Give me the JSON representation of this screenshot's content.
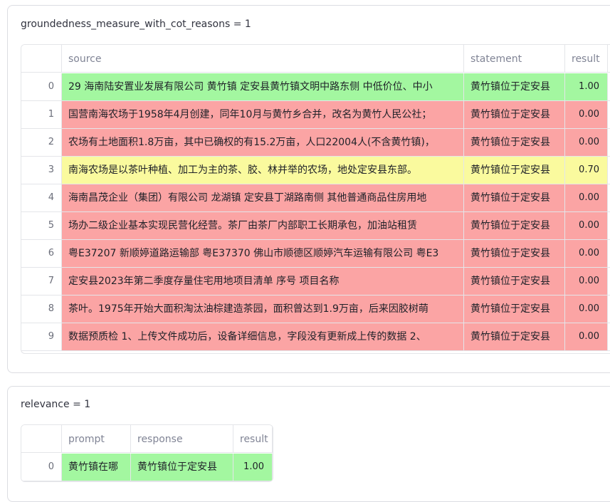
{
  "groundedness": {
    "title": "groundedness_measure_with_cot_reasons = 1",
    "columns": [
      "source",
      "statement",
      "result"
    ],
    "rows": [
      {
        "index": "0",
        "source": "29 海南陆安置业发展有限公司 黄竹镇 定安县黄竹镇文明中路东侧 中低价位、中小",
        "statement": "黄竹镇位于定安县",
        "result": "1.00",
        "color": "green"
      },
      {
        "index": "1",
        "source": "国营南海农场于1958年4月创建，同年10月与黄竹乡合并，改名为黄竹人民公社；",
        "statement": "黄竹镇位于定安县",
        "result": "0.00",
        "color": "red"
      },
      {
        "index": "2",
        "source": "农场有土地面积1.8万亩，其中已确权的有15.2万亩，人口22004人(不含黄竹镇)，",
        "statement": "黄竹镇位于定安县",
        "result": "0.00",
        "color": "red"
      },
      {
        "index": "3",
        "source": "南海农场是以茶叶种植、加工为主的茶、胶、林并举的农场，地处定安县东部。",
        "statement": "黄竹镇位于定安县",
        "result": "0.70",
        "color": "yellow"
      },
      {
        "index": "4",
        "source": "海南昌茂企业（集团）有限公司 龙湖镇 定安县丁湖路南侧 其他普通商品住房用地",
        "statement": "黄竹镇位于定安县",
        "result": "0.00",
        "color": "red"
      },
      {
        "index": "5",
        "source": "场办二级企业基本实现民营化经营。茶厂由茶厂内部职工长期承包，加油站租赁",
        "statement": "黄竹镇位于定安县",
        "result": "0.00",
        "color": "red"
      },
      {
        "index": "6",
        "source": "粤E37207 新顺婷道路运输部  粤E37370 佛山市顺德区顺婷汽车运输有限公司  粤E3",
        "statement": "黄竹镇位于定安县",
        "result": "0.00",
        "color": "red"
      },
      {
        "index": "7",
        "source": "定安县2023年第二季度存量住宅用地项目清单                         序号 项目名称",
        "statement": "黄竹镇位于定安县",
        "result": "0.00",
        "color": "red"
      },
      {
        "index": "8",
        "source": "茶叶。1975年开始大面积淘汰油棕建造茶园，面积曾达到1.9万亩，后来因胶树萌",
        "statement": "黄竹镇位于定安县",
        "result": "0.00",
        "color": "red"
      },
      {
        "index": "9",
        "source": "数据预质检 1、上传文件成功后，设备详细信息，字段没有更新成上传的数据 2、",
        "statement": "黄竹镇位于定安县",
        "result": "0.00",
        "color": "red"
      }
    ]
  },
  "relevance": {
    "title": "relevance = 1",
    "columns": [
      "prompt",
      "response",
      "result"
    ],
    "rows": [
      {
        "index": "0",
        "prompt": "黄竹镇在哪",
        "response": "黄竹镇位于定安县",
        "result": "1.00",
        "color": "green"
      }
    ]
  }
}
